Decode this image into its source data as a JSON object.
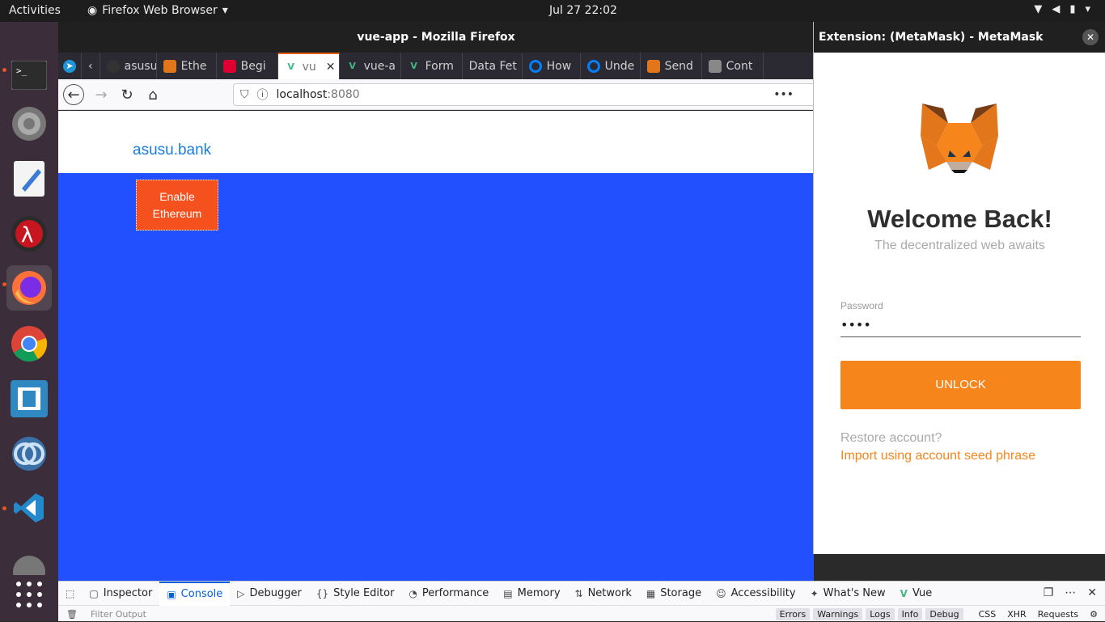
{
  "topbar": {
    "activities": "Activities",
    "app_menu": "Firefox Web Browser",
    "clock": "Jul 27  22:02"
  },
  "window": {
    "title": "vue-app - Mozilla Firefox"
  },
  "tabs": [
    {
      "label": "asusu",
      "icon": "github-icon"
    },
    {
      "label": "Ethe",
      "icon": "metamask-icon"
    },
    {
      "label": "Begi",
      "icon": "angular-icon"
    },
    {
      "label": "vu",
      "icon": "vue-icon",
      "selected": true
    },
    {
      "label": "vue-a",
      "icon": "vue-icon"
    },
    {
      "label": "Form",
      "icon": "vue-icon"
    },
    {
      "label": "Data Fet",
      "icon": "blank-icon"
    },
    {
      "label": "How",
      "icon": "digitalocean-icon"
    },
    {
      "label": "Unde",
      "icon": "digitalocean-icon"
    },
    {
      "label": "Send",
      "icon": "metamask-icon"
    },
    {
      "label": "Cont",
      "icon": "doc-icon"
    }
  ],
  "url": {
    "host": "localhost",
    "port": ":8080"
  },
  "page": {
    "brand": "asusu.bank",
    "enable_button": "Enable Ethereum"
  },
  "metamask": {
    "window_title": "Extension: (MetaMask) - MetaMask Notifica...",
    "welcome": "Welcome Back!",
    "subtitle": "The decentralized web awaits",
    "password_label": "Password",
    "password_value": "••••",
    "unlock_label": "UNLOCK",
    "restore_text": "Restore account?",
    "import_link": "Import using account seed phrase"
  },
  "devtools": {
    "tabs": [
      {
        "label": "Inspector",
        "icon": "inspector-icon"
      },
      {
        "label": "Console",
        "icon": "console-icon",
        "selected": true
      },
      {
        "label": "Debugger",
        "icon": "debugger-icon"
      },
      {
        "label": "Style Editor",
        "icon": "style-editor-icon"
      },
      {
        "label": "Performance",
        "icon": "performance-icon"
      },
      {
        "label": "Memory",
        "icon": "memory-icon"
      },
      {
        "label": "Network",
        "icon": "network-icon"
      },
      {
        "label": "Storage",
        "icon": "storage-icon"
      },
      {
        "label": "Accessibility",
        "icon": "accessibility-icon"
      },
      {
        "label": "What's New",
        "icon": "whats-new-icon"
      },
      {
        "label": "Vue",
        "icon": "vue-icon"
      }
    ],
    "filter_placeholder": "Filter Output",
    "levels": [
      "Errors",
      "Warnings",
      "Logs",
      "Info",
      "Debug"
    ],
    "types": [
      "CSS",
      "XHR",
      "Requests"
    ]
  },
  "colors": {
    "page_bg": "#2350ff",
    "brand": "#1a7ee6",
    "enable_button": "#f4511e",
    "metamask_orange": "#f6851b"
  }
}
